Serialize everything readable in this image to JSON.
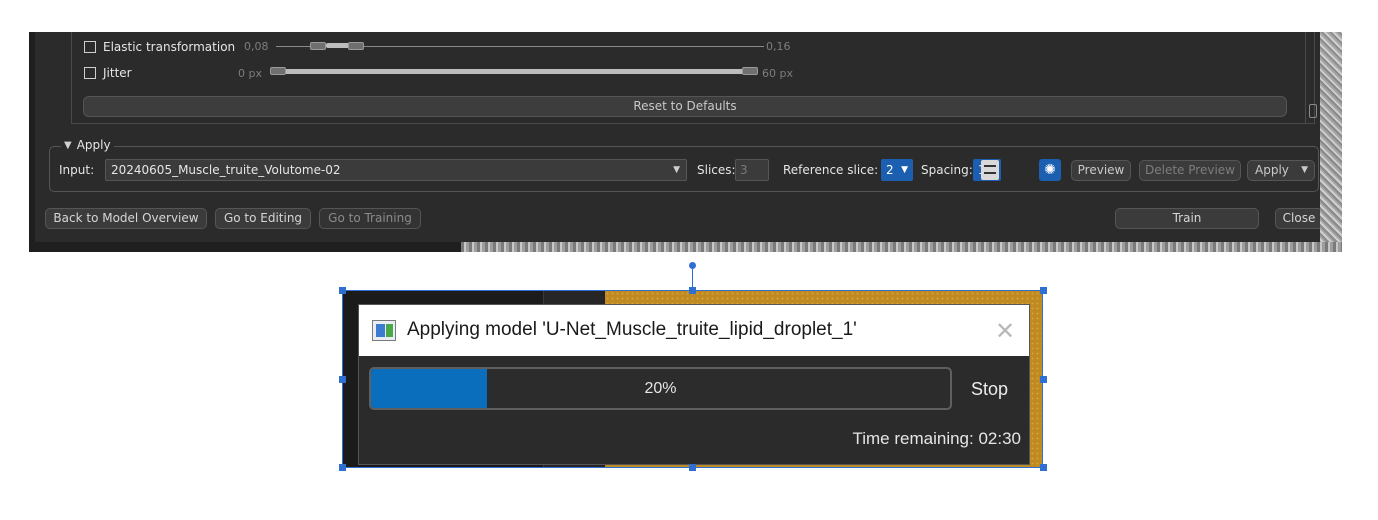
{
  "augmentation": {
    "elastic": {
      "label": "Elastic transformation",
      "min_label": "0,08",
      "max_label": "0,16"
    },
    "jitter": {
      "label": "Jitter",
      "min_label": "0 px",
      "max_label": "60 px"
    },
    "reset_label": "Reset to Defaults"
  },
  "apply": {
    "group_label": "Apply",
    "input_label": "Input:",
    "input_value": "20240605_Muscle_truite_Volutome-02",
    "slices_label": "Slices:",
    "slices_value": "3",
    "reference_label": "Reference slice:",
    "reference_value": "2",
    "spacing_label": "Spacing:",
    "spacing_value": "1",
    "preview_label": "Preview",
    "delete_preview_label": "Delete Preview",
    "apply_label": "Apply"
  },
  "bottom_buttons": {
    "back": "Back to Model Overview",
    "editing": "Go to Editing",
    "training": "Go to Training",
    "train": "Train",
    "close": "Close"
  },
  "dialog": {
    "title": "Applying model 'U-Net_Muscle_truite_lipid_droplet_1'",
    "progress_percent": 20,
    "progress_text": "20%",
    "stop_label": "Stop",
    "time_remaining": "Time remaining: 02:30"
  },
  "colors": {
    "accent_blue": "#0a6ebd",
    "panel_bg": "#2b2b2b",
    "selection_blue": "#2f6fd1"
  }
}
